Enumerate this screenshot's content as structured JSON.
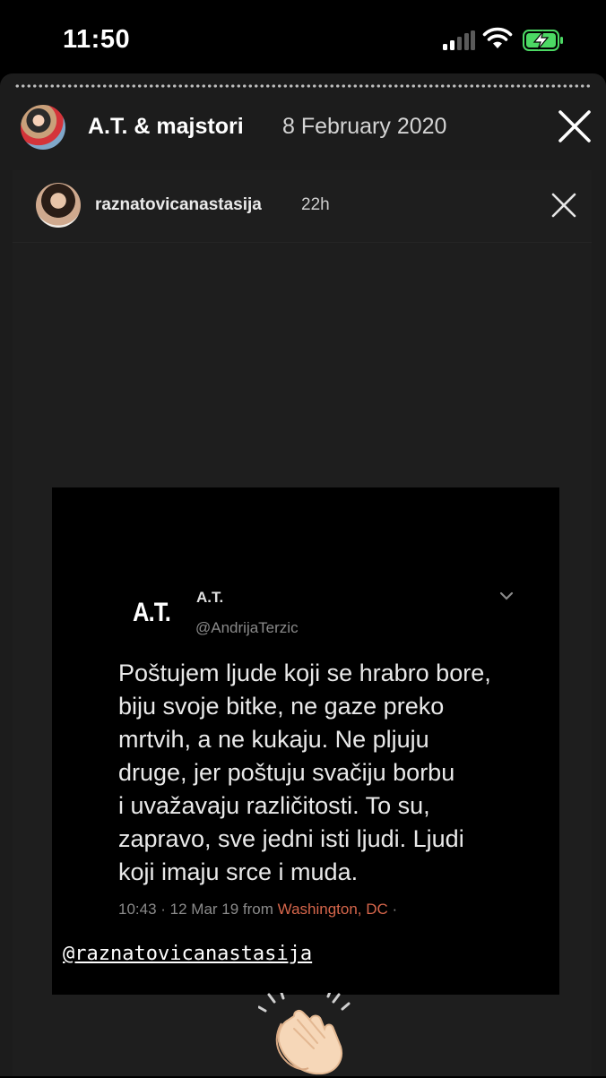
{
  "status_bar": {
    "time": "11:50",
    "signal_icon": "cellular-signal-icon",
    "wifi_icon": "wifi-icon",
    "battery_icon": "battery-charging-icon",
    "battery_color": "#4cd964"
  },
  "story": {
    "author": "A.T. & majstori",
    "date": "8 February 2020",
    "close_icon": "close-icon",
    "shared_post": {
      "username": "raznatovicanastasija",
      "age": "22h",
      "close_icon": "close-icon"
    },
    "tweet": {
      "logo": "A.T.",
      "display_name": "A.T.",
      "handle": "@AndrijaTerzic",
      "text_lines": [
        "Poštujem ljude koji se hrabro bore,",
        "biju svoje bitke, ne gaze preko",
        "mrtvih, a ne kukaju. Ne pljuju",
        "druge, jer poštuju svačiju borbu",
        "i uvažavaju različitosti. To su,",
        "zapravo, sve jedni isti ljudi. Ljudi",
        "koji imaju srce i muda."
      ],
      "timestamp": "10:43 · 12 Mar 19 from",
      "location": "Washington, DC",
      "trailing": " ·",
      "location_color": "#d6664b"
    },
    "mention_sticker": "@raznatovicanastasija",
    "clapping_sticker_icon": "clapping-hands-icon"
  }
}
